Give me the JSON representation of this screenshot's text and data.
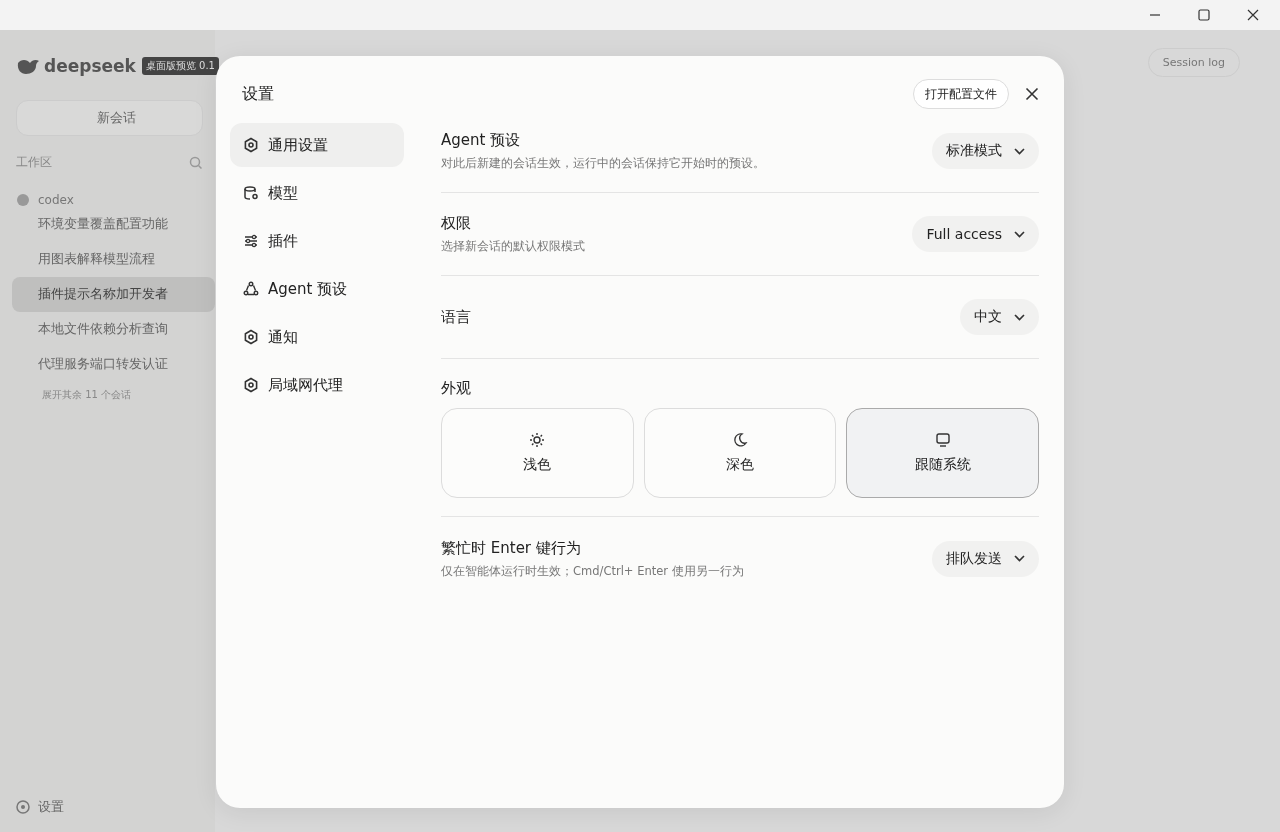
{
  "app": {
    "logo": "deepseek",
    "badge": "桌面版预览 0.1",
    "new_chat": "新会话",
    "workspace_label": "工作区",
    "project": "codex",
    "sessions": [
      {
        "title": "环境变量覆盖配置功能",
        "selected": false
      },
      {
        "title": "用图表解释模型流程",
        "selected": false
      },
      {
        "title": "插件提示名称加开发者",
        "selected": true
      },
      {
        "title": "本地文件依赖分析查询",
        "selected": false
      },
      {
        "title": "代理服务端口转发认证",
        "selected": false
      }
    ],
    "more_sessions": "展开其余 11 个会话",
    "settings": "设置",
    "session_log": "Session log"
  },
  "dialog": {
    "title": "设置",
    "open_config": "打开配置文件",
    "nav": [
      {
        "label": "通用设置",
        "kind": "general",
        "selected": true
      },
      {
        "label": "模型",
        "kind": "model",
        "selected": false
      },
      {
        "label": "插件",
        "kind": "plugin",
        "selected": false
      },
      {
        "label": "Agent 预设",
        "kind": "agent",
        "selected": false
      },
      {
        "label": "通知",
        "kind": "general",
        "selected": false
      },
      {
        "label": "局域网代理",
        "kind": "general",
        "selected": false
      }
    ],
    "rows": [
      {
        "kind": "select",
        "label": "Agent 预设",
        "description": "对此后新建的会话生效，运行中的会话保持它开始时的预设。",
        "value": "标准模式"
      },
      {
        "kind": "select",
        "label": "权限",
        "description": "选择新会话的默认权限模式",
        "value": "Full access"
      },
      {
        "kind": "select",
        "label": "语言",
        "value": "中文"
      },
      {
        "kind": "appearance",
        "label": "外观",
        "options": [
          {
            "label": "浅色",
            "kind": "light",
            "selected": false
          },
          {
            "label": "深色",
            "kind": "dark",
            "selected": false
          },
          {
            "label": "跟随系统",
            "kind": "system",
            "selected": true
          }
        ]
      },
      {
        "kind": "select",
        "label": "繁忙时 Enter 键行为",
        "description": "仅在智能体运行时生效；Cmd/Ctrl+ Enter 使用另一行为",
        "value": "排队发送"
      }
    ]
  }
}
